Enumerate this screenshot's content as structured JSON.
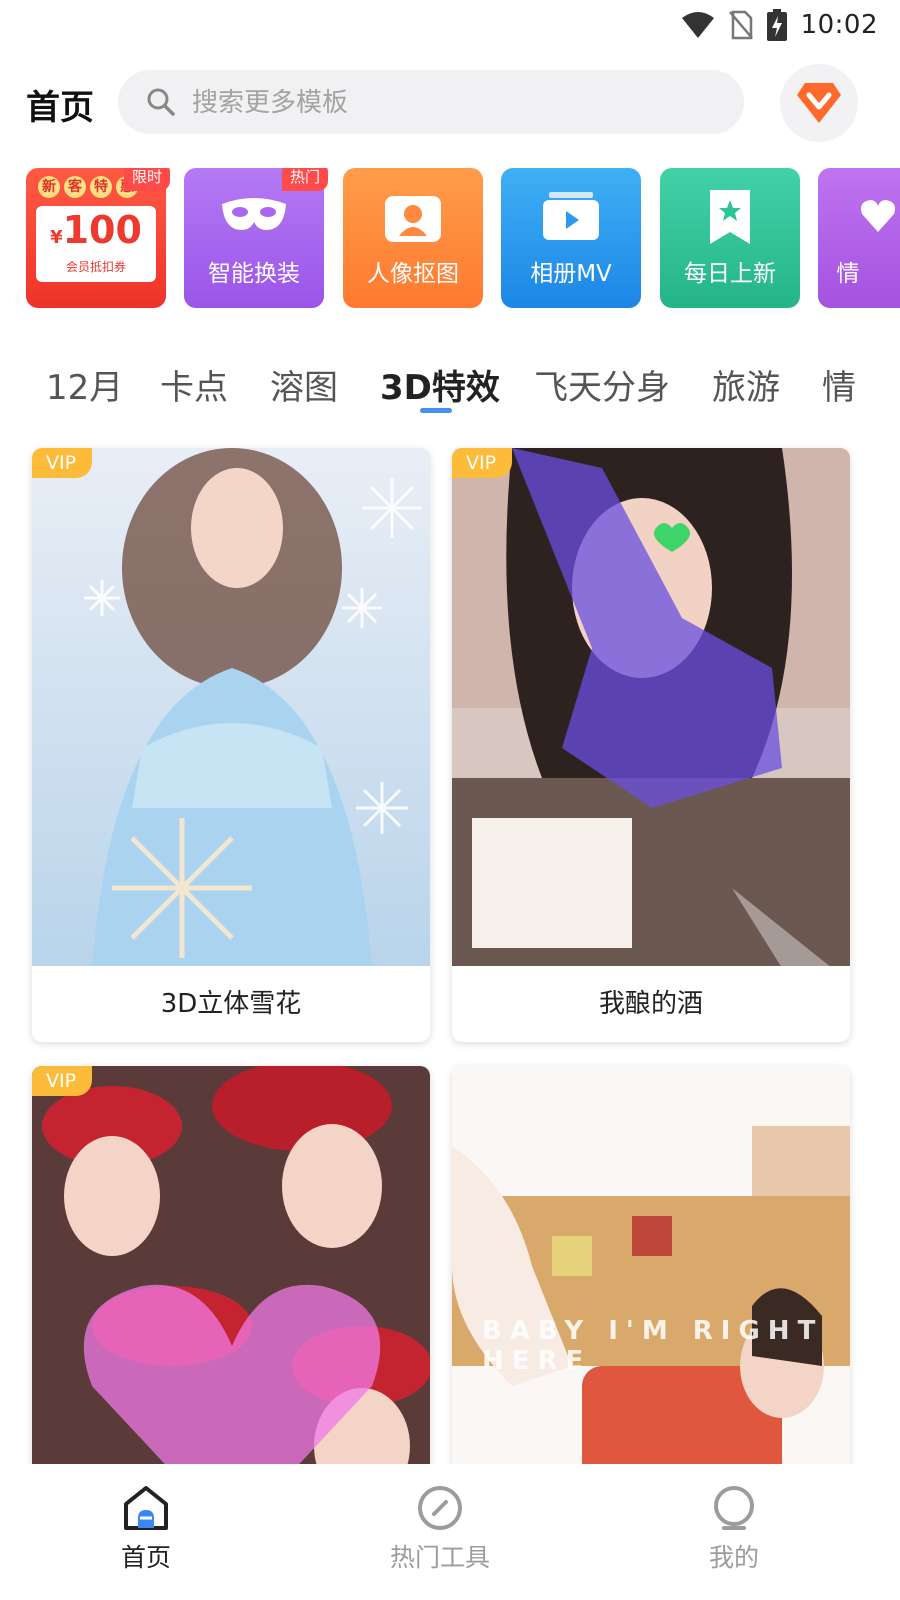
{
  "status_bar": {
    "time": "10:02",
    "icons": [
      "wifi-icon",
      "no-sim-icon",
      "battery-charging-icon"
    ]
  },
  "header": {
    "title": "首页",
    "search_placeholder": "搜索更多模板",
    "vip_icon": "vip-diamond-icon"
  },
  "shortcuts": {
    "coupon": {
      "badge": "限时",
      "header_chars": [
        "新",
        "客",
        "特",
        "惠"
      ],
      "currency": "¥",
      "amount": "100",
      "desc": "会员抵扣券"
    },
    "items": [
      {
        "label": "智能换装",
        "badge": "热门",
        "icon": "mask-icon",
        "color": "#a866f0"
      },
      {
        "label": "人像抠图",
        "badge": "",
        "icon": "portrait-icon",
        "color": "#ff8a3d"
      },
      {
        "label": "相册MV",
        "badge": "",
        "icon": "video-album-icon",
        "color": "#2c98f0"
      },
      {
        "label": "每日上新",
        "badge": "",
        "icon": "bookmark-star-icon",
        "color": "#2ec49a"
      },
      {
        "label": "情",
        "badge": "",
        "icon": "heart-icon",
        "color": "#b262e6"
      }
    ]
  },
  "tabs": [
    {
      "label": "12月"
    },
    {
      "label": "卡点"
    },
    {
      "label": "溶图"
    },
    {
      "label": "3D特效",
      "active": true
    },
    {
      "label": "飞天分身"
    },
    {
      "label": "旅游"
    },
    {
      "label": "情"
    }
  ],
  "cards": [
    {
      "title": "3D立体雪花",
      "vip": "VIP"
    },
    {
      "title": "我酿的酒",
      "vip": "VIP"
    },
    {
      "title": "",
      "vip": "VIP"
    },
    {
      "title": "",
      "vip": "",
      "caption": "BABY I'M RIGHT HERE"
    }
  ],
  "bottom_nav": [
    {
      "label": "首页",
      "icon": "home-icon",
      "active": true
    },
    {
      "label": "热门工具",
      "icon": "compass-icon"
    },
    {
      "label": "我的",
      "icon": "profile-icon"
    }
  ]
}
